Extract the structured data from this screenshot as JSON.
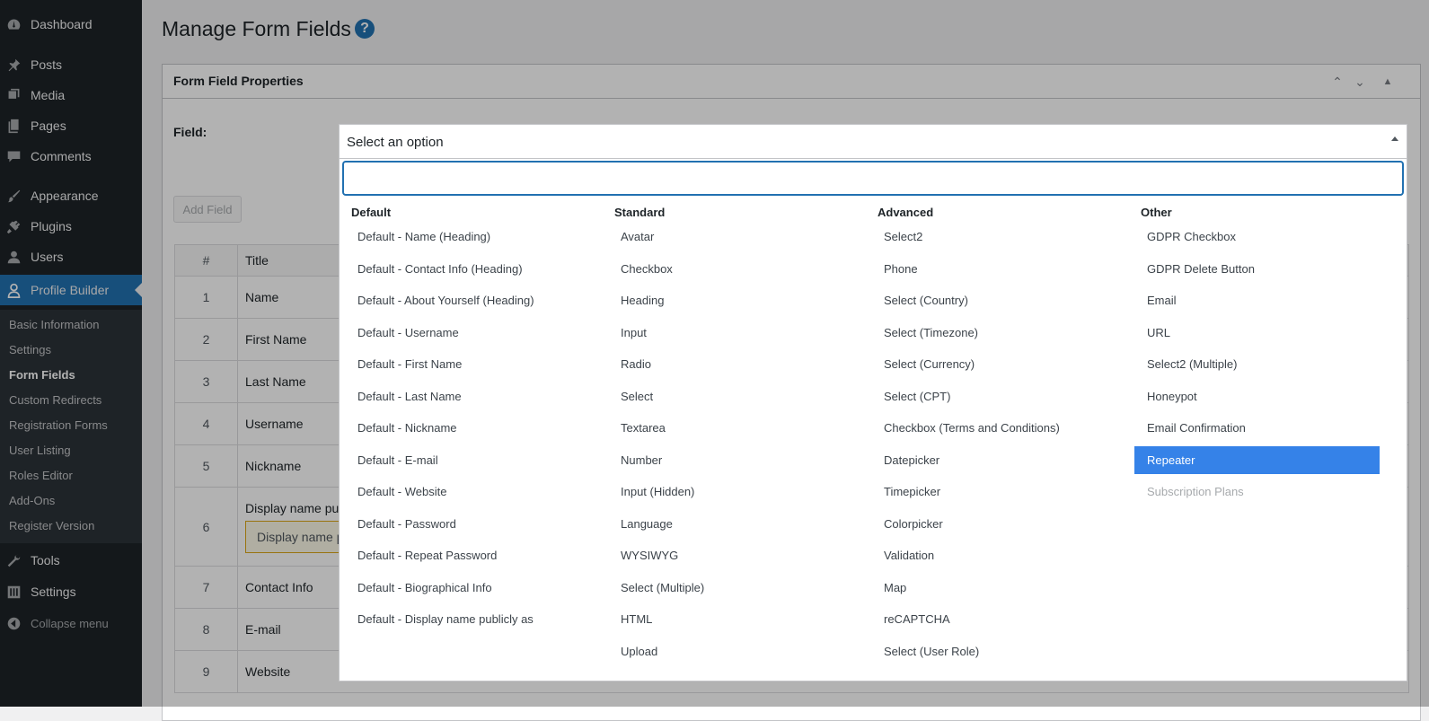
{
  "sidebar": {
    "items": [
      {
        "label": "Dashboard",
        "icon": "dashboard-icon"
      },
      {
        "label": "Posts",
        "icon": "pin-icon"
      },
      {
        "label": "Media",
        "icon": "media-icon"
      },
      {
        "label": "Pages",
        "icon": "pages-icon"
      },
      {
        "label": "Comments",
        "icon": "comments-icon"
      },
      {
        "label": "Appearance",
        "icon": "brush-icon"
      },
      {
        "label": "Plugins",
        "icon": "plugin-icon"
      },
      {
        "label": "Users",
        "icon": "user-icon"
      },
      {
        "label": "Profile Builder",
        "icon": "profile-icon"
      },
      {
        "label": "Tools",
        "icon": "wrench-icon"
      },
      {
        "label": "Settings",
        "icon": "sliders-icon"
      }
    ],
    "submenu": [
      "Basic Information",
      "Settings",
      "Form Fields",
      "Custom Redirects",
      "Registration Forms",
      "User Listing",
      "Roles Editor",
      "Add-Ons",
      "Register Version"
    ],
    "collapse_label": "Collapse menu"
  },
  "page": {
    "title": "Manage Form Fields",
    "help": "?",
    "postbox_title": "Form Field Properties",
    "field_label": "Field:",
    "add_field": "Add Field"
  },
  "table": {
    "headers": [
      "#",
      "Title"
    ],
    "rows": [
      {
        "num": "1",
        "title": "Name"
      },
      {
        "num": "2",
        "title": "First Name"
      },
      {
        "num": "3",
        "title": "Last Name"
      },
      {
        "num": "4",
        "title": "Username"
      },
      {
        "num": "5",
        "title": "Nickname"
      },
      {
        "num": "6",
        "title": "Display name pu",
        "input": "Display name p"
      },
      {
        "num": "7",
        "title": "Contact Info"
      },
      {
        "num": "8",
        "title": "E-mail"
      },
      {
        "num": "9",
        "title": "Website"
      }
    ]
  },
  "select": {
    "value": "Select an option",
    "search_value": "",
    "groups": [
      {
        "label": "Default",
        "options": [
          "Default - Name (Heading)",
          "Default - Contact Info (Heading)",
          "Default - About Yourself (Heading)",
          "Default - Username",
          "Default - First Name",
          "Default - Last Name",
          "Default - Nickname",
          "Default - E-mail",
          "Default - Website",
          "Default - Password",
          "Default - Repeat Password",
          "Default - Biographical Info",
          "Default - Display name publicly as"
        ]
      },
      {
        "label": "Standard",
        "options": [
          "Avatar",
          "Checkbox",
          "Heading",
          "Input",
          "Radio",
          "Select",
          "Textarea",
          "Number",
          "Input (Hidden)",
          "Language",
          "WYSIWYG",
          "Select (Multiple)",
          "HTML",
          "Upload"
        ]
      },
      {
        "label": "Advanced",
        "options": [
          "Select2",
          "Phone",
          "Select (Country)",
          "Select (Timezone)",
          "Select (Currency)",
          "Select (CPT)",
          "Checkbox (Terms and Conditions)",
          "Datepicker",
          "Timepicker",
          "Colorpicker",
          "Validation",
          "Map",
          "reCAPTCHA",
          "Select (User Role)"
        ]
      },
      {
        "label": "Other",
        "options": [
          "GDPR Checkbox",
          "GDPR Delete Button",
          "Email",
          "URL",
          "Select2 (Multiple)",
          "Honeypot",
          "Email Confirmation",
          "Repeater",
          "Subscription Plans"
        ]
      }
    ],
    "highlighted": "Repeater",
    "disabled": "Subscription Plans"
  },
  "colors": {
    "sidebar_bg": "#1d2327",
    "accent": "#2271b1",
    "highlight": "#3582e8"
  }
}
